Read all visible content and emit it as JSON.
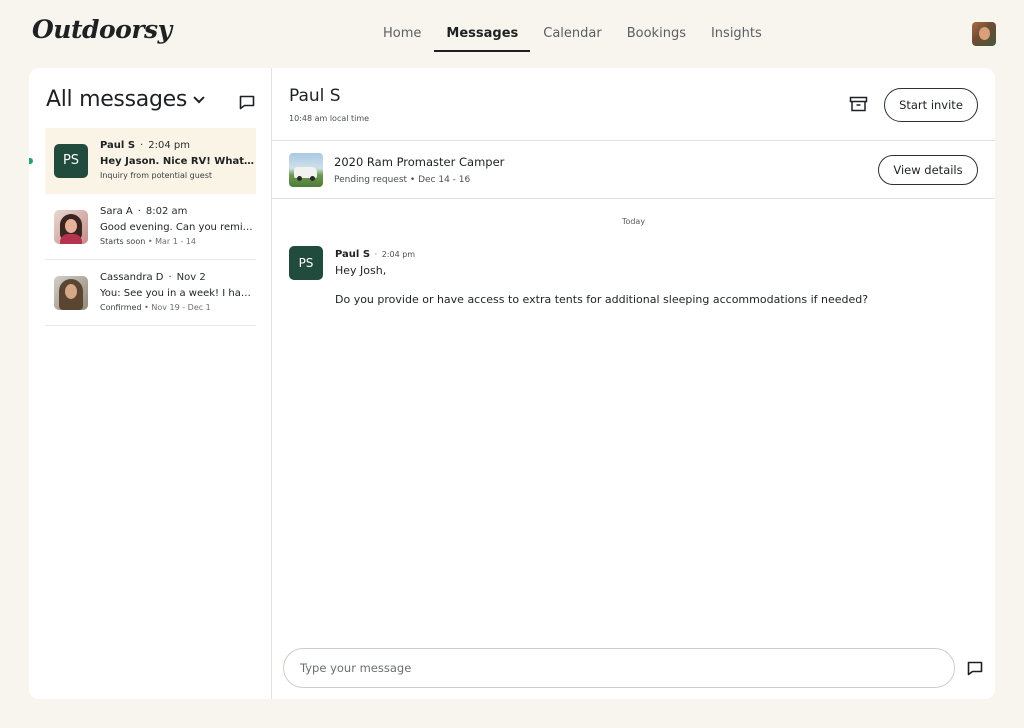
{
  "brand": {
    "name": "Outdoorsy"
  },
  "nav": {
    "items": [
      {
        "label": "Home"
      },
      {
        "label": "Messages",
        "active": true
      },
      {
        "label": "Calendar"
      },
      {
        "label": "Bookings"
      },
      {
        "label": "Insights"
      }
    ]
  },
  "sidebar": {
    "title": "All messages",
    "conversations": [
      {
        "name": "Paul S",
        "time": "2:04 pm",
        "preview": "Hey Jason. Nice RV! What size is the tent?",
        "status": "Inquiry from potential guest",
        "dates": "",
        "initials": "PS",
        "unread": true,
        "active": true
      },
      {
        "name": "Sara A",
        "time": "8:02 am",
        "preview": "Good evening. Can you remind me of the check-in time?",
        "status": "Starts soon",
        "dates": "Mar 1 - 14",
        "initials": "",
        "unread": false,
        "active": false
      },
      {
        "name": "Cassandra D",
        "time": "Nov 2",
        "preview": "You: See you in a week! I have all your details.",
        "status": "Confirmed",
        "dates": "Nov 19 - Dec 1",
        "initials": "",
        "unread": false,
        "active": false
      }
    ]
  },
  "thread": {
    "contact_name": "Paul S",
    "local_time": "10:48 am local time",
    "start_invite_label": "Start invite",
    "listing": {
      "title": "2020 Ram Promaster Camper",
      "subtitle": "Pending request • Dec 14 - 16",
      "view_details_label": "View details"
    },
    "day_label": "Today",
    "messages": [
      {
        "initials": "PS",
        "sender": "Paul S",
        "time": "2:04 pm",
        "lines": [
          "Hey Josh,",
          "Do you provide or have access to extra tents for additional sleeping accommodations if needed?"
        ]
      }
    ],
    "composer": {
      "placeholder": "Type your message",
      "value": ""
    }
  },
  "colors": {
    "background": "#f8f5ee",
    "accent_dark_green": "#214b3d",
    "unread_dot": "#23a36b",
    "active_row": "#faf4e6"
  },
  "icons": {
    "compose": "chat-bubble-icon",
    "archive": "archive-box-icon",
    "send": "chat-bubble-icon",
    "dropdown": "chevron-down-icon"
  }
}
